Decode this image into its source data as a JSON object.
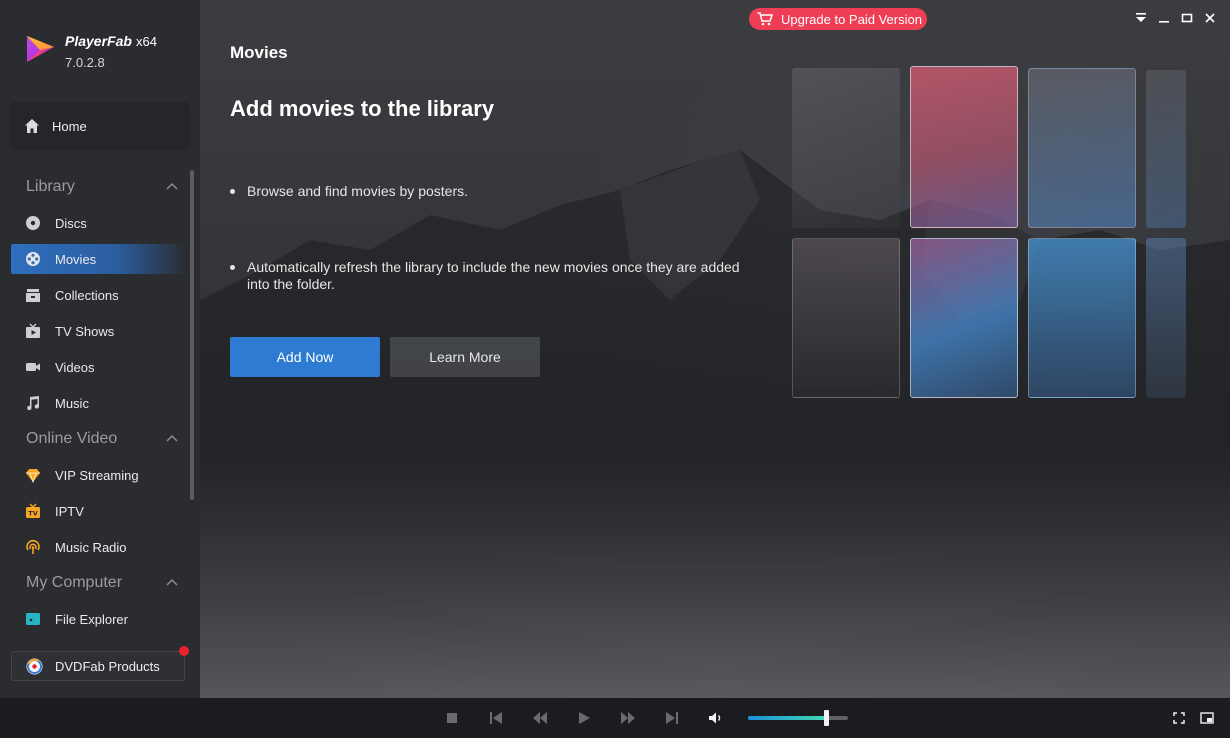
{
  "app": {
    "brand": "PlayerFab",
    "arch": "x64",
    "version": "7.0.2.8"
  },
  "sidebar": {
    "home": "Home",
    "sections": {
      "library": "Library",
      "online_video": "Online Video",
      "my_computer": "My Computer"
    },
    "items": {
      "discs": "Discs",
      "movies": "Movies",
      "collections": "Collections",
      "tv_shows": "TV Shows",
      "videos": "Videos",
      "music": "Music",
      "vip_streaming": "VIP Streaming",
      "iptv": "IPTV",
      "music_radio": "Music Radio",
      "file_explorer": "File Explorer"
    },
    "products": "DVDFab Products"
  },
  "main": {
    "page_title": "Movies",
    "headline": "Add movies to the library",
    "bullets": [
      "Browse and find movies by posters.",
      "Automatically refresh the library to include the new movies once they are added into the folder."
    ],
    "add_now": "Add Now",
    "learn_more": "Learn More"
  },
  "titlebar": {
    "upgrade": "Upgrade to Paid Version"
  },
  "player": {
    "volume_level": 0.78
  },
  "colors": {
    "accent": "#2d7bd2",
    "upgrade": "#ee3e55",
    "badge": "#e8202f"
  }
}
